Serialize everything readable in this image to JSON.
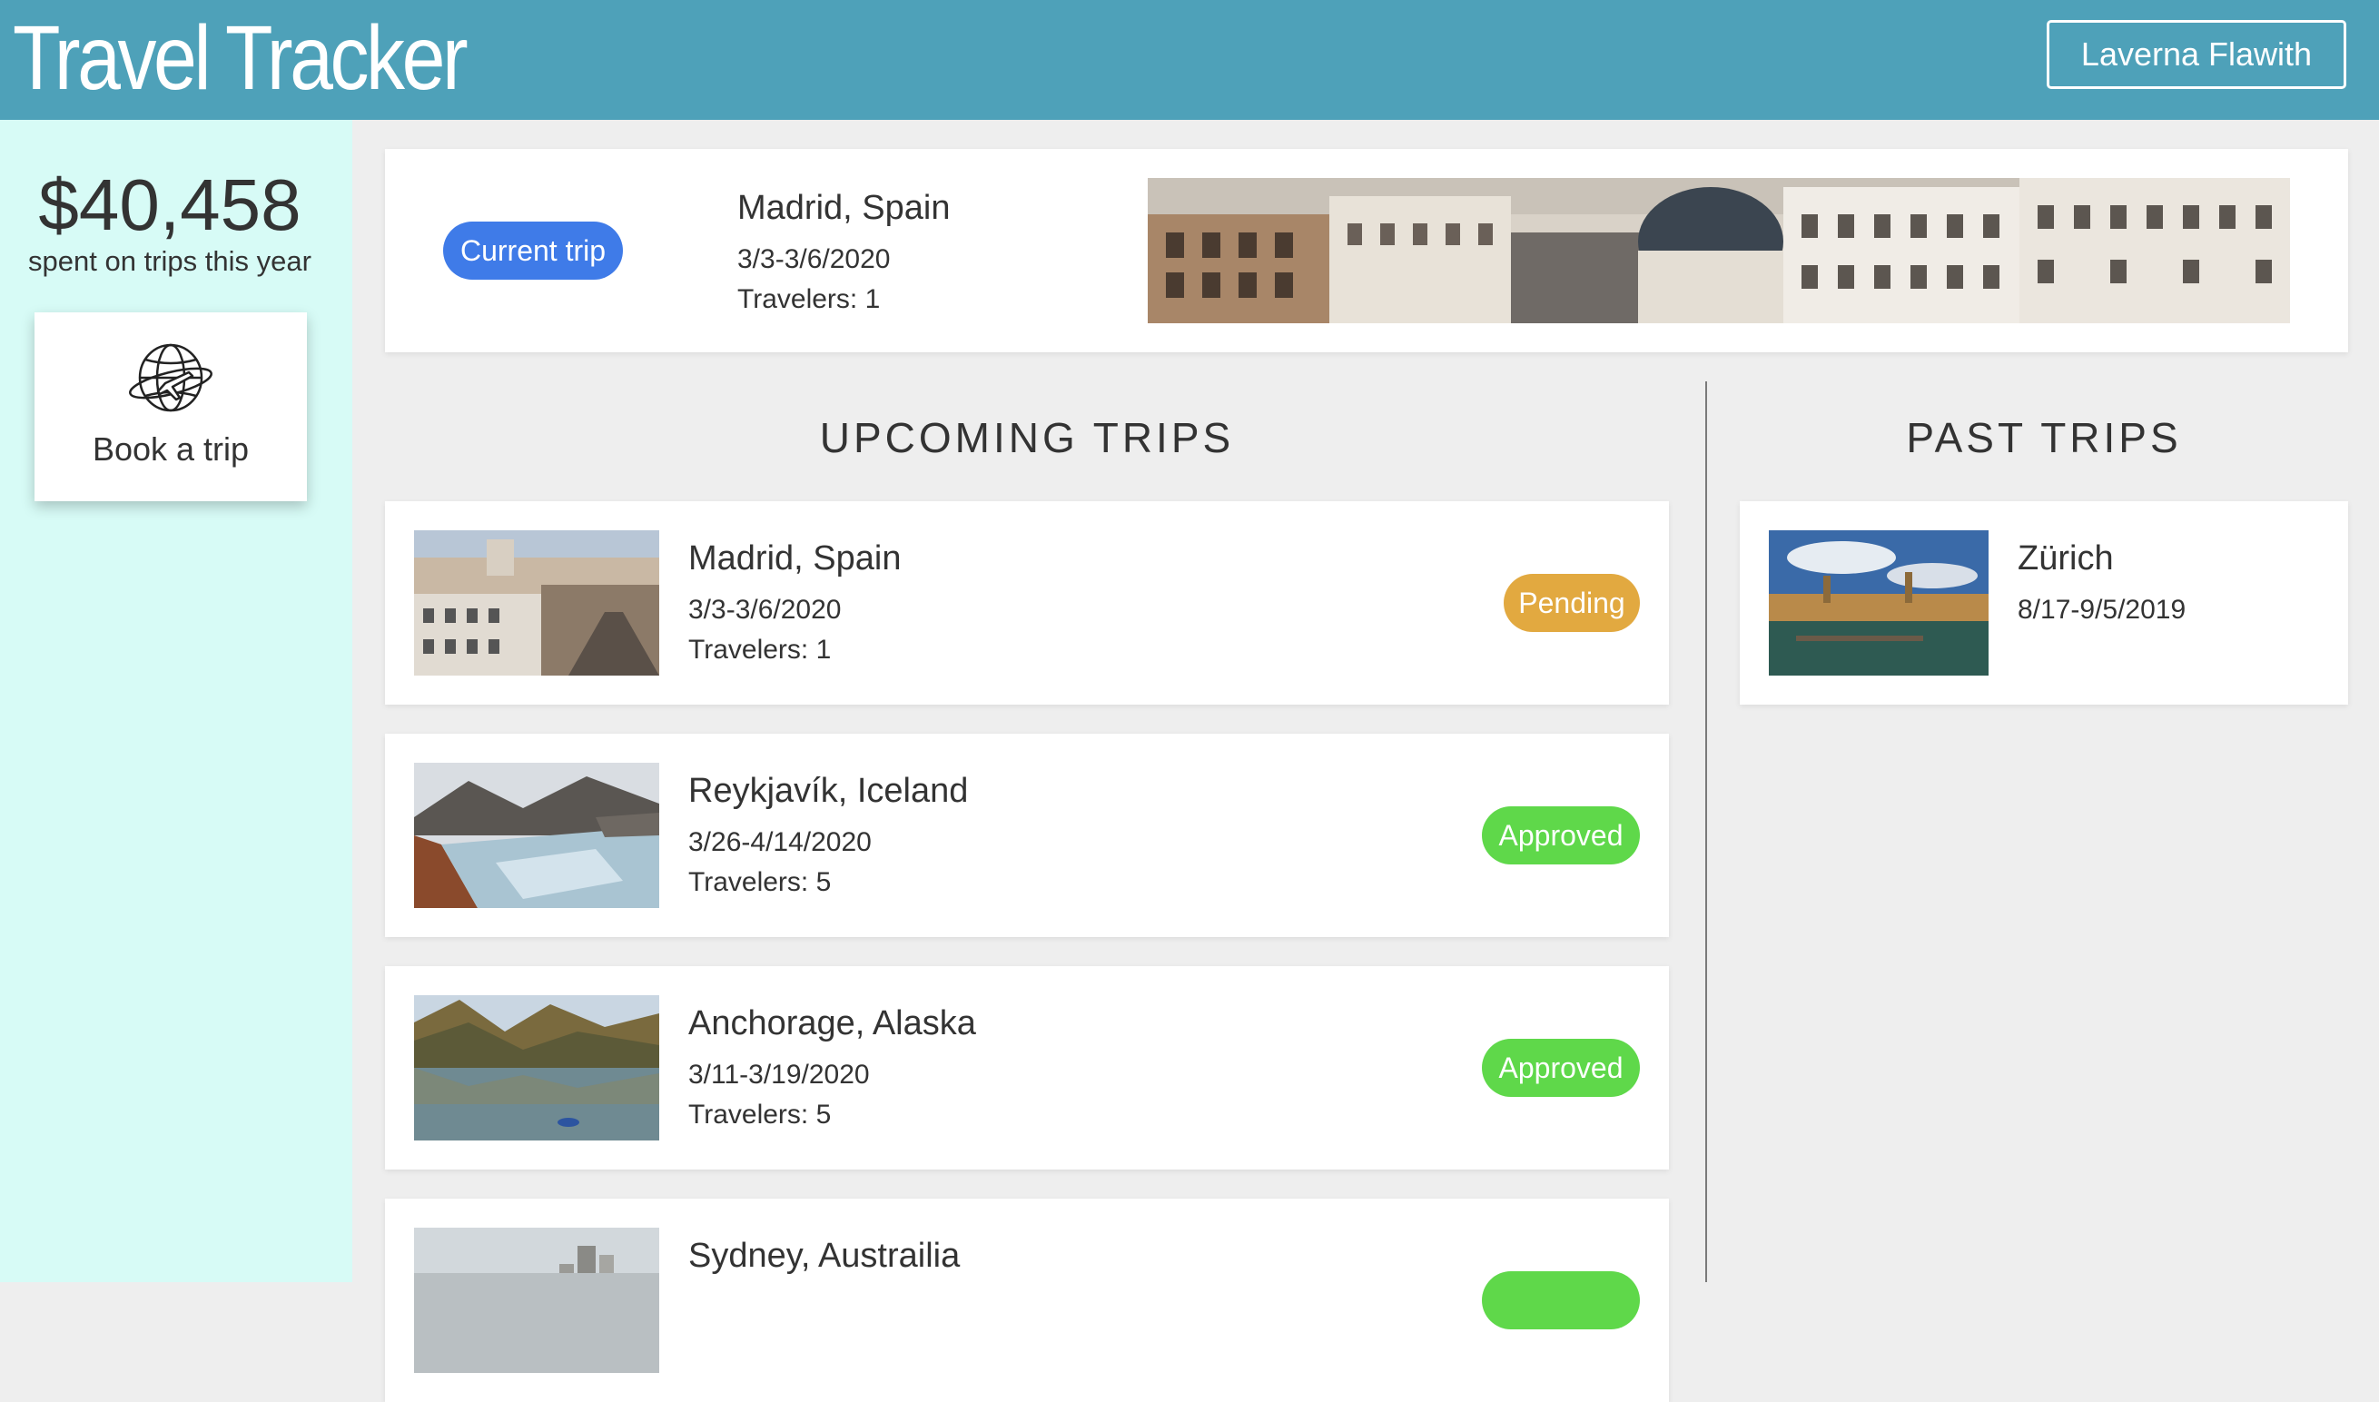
{
  "header": {
    "app_title": "Travel Tracker",
    "user_name": "Laverna Flawith"
  },
  "sidebar": {
    "spent_amount": "$40,458",
    "spent_caption": "spent on trips this year",
    "book_label": "Book a trip",
    "book_icon": "globe-plane-icon"
  },
  "current_trip": {
    "badge": "Current trip",
    "destination": "Madrid, Spain",
    "dates": "3/3-3/6/2020",
    "travelers": "Travelers: 1",
    "photo": "madrid-cityscape-photo"
  },
  "upcoming": {
    "heading": "UPCOMING TRIPS",
    "trips": [
      {
        "destination": "Madrid, Spain",
        "dates": "3/3-3/6/2020",
        "travelers": "Travelers: 1",
        "status": "Pending",
        "photo": "madrid-photo"
      },
      {
        "destination": "Reykjavík, Iceland",
        "dates": "3/26-4/14/2020",
        "travelers": "Travelers: 5",
        "status": "Approved",
        "photo": "glacier-photo"
      },
      {
        "destination": "Anchorage, Alaska",
        "dates": "3/11-3/19/2020",
        "travelers": "Travelers: 5",
        "status": "Approved",
        "photo": "alaska-lake-photo"
      },
      {
        "destination": "Sydney, Austrailia",
        "photo": "sydney-photo"
      }
    ]
  },
  "past": {
    "heading": "PAST TRIPS",
    "trips": [
      {
        "destination": "Zürich",
        "dates": "8/17-9/5/2019",
        "photo": "zurich-photo"
      }
    ]
  },
  "colors": {
    "header_bg": "#4ea1b9",
    "sidebar_bg": "#d7fbf6",
    "page_bg": "#eeeeee",
    "current_badge": "#3f7be8",
    "pending": "#e2a940",
    "approved": "#5fd84a"
  }
}
